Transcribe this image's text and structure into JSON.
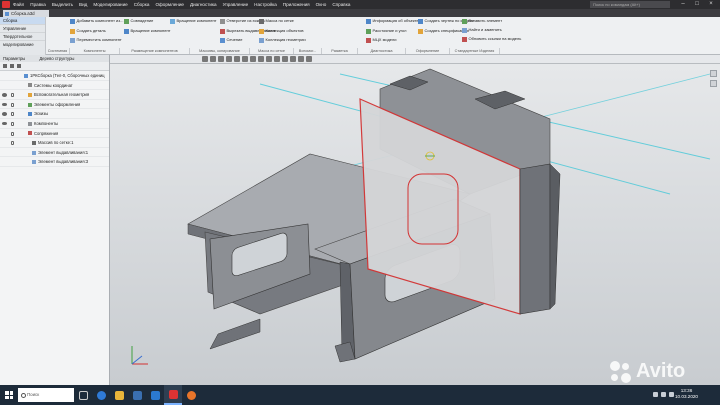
{
  "menu": {
    "items": [
      "Файл",
      "Правка",
      "Выделить",
      "Вид",
      "Моделирование",
      "Сборка",
      "Оформление",
      "Диагностика",
      "Управление",
      "Настройка",
      "Приложения",
      "Окно",
      "Справка"
    ],
    "search_placeholder": "Поиск по командам (Alt+)"
  },
  "document_tab": {
    "label": "Сборка.a3d"
  },
  "ribbon": {
    "left_items": [
      "Сборка",
      "Управление",
      "Твердотельное моделирование"
    ],
    "tools": {
      "add_component": "Добавить компонент из...",
      "create_part": "Создать деталь",
      "place_copy": "Переместить компонент",
      "coincide": "Совпадение",
      "array": "Вращение компонент",
      "rotate_comp": "Вращение компонент",
      "hole": "Отверстие из эскиза",
      "cut": "Вырезать выдавливанием",
      "section": "Сечение",
      "mass": "Масса по сетке",
      "collision": "Коллекция объектов",
      "check": "Коллекция геометрии",
      "info": "Информация об объекте",
      "measure": "Расстояние и угол",
      "mcx": "МЦХ модели",
      "create_drawing": "Создать чертеж по модели",
      "create_spec": "Создать спецификацию",
      "insert_view": "Вставить элемент",
      "find_replace": "Найти и заменить",
      "update_links": "Обновить ссылки на модель"
    },
    "groups": [
      "Системная",
      "Компоненты",
      "Размещение компонентов",
      "Массивы, копирование",
      "Масса по сетке",
      "Вспомог...",
      "Разметка",
      "Диагностика",
      "Оформление",
      "Стандартные Изделия"
    ]
  },
  "left_panel": {
    "tabs": [
      "Параметры",
      "Дерево структуры"
    ],
    "tree": [
      "1РКСборка (Тел-0, Сборочных единиц",
      "Системы координат",
      "Вспомогательная геометрия",
      "Элементы оформления",
      "Эскизы",
      "Компоненты",
      "Сопряжения",
      "Массив по сетке:1",
      "Элемент выдавливания:1",
      "Элемент выдавливания:3"
    ]
  },
  "taskbar": {
    "search_placeholder": "Поиск",
    "time": "13:36",
    "date": "10.03.2020"
  },
  "watermark": {
    "text": "Avito"
  },
  "colors": {
    "accent": "#5a8fd0",
    "selection": "#d33333",
    "menubar": "#2d2d30",
    "model": "#8e9196"
  }
}
